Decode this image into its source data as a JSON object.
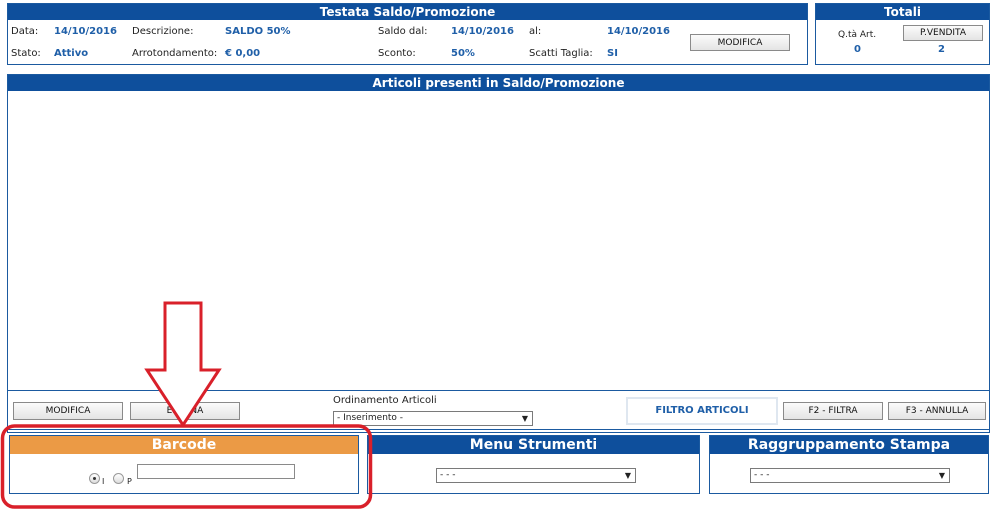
{
  "header": {
    "title": "Testata Saldo/Promozione",
    "data_label": "Data:",
    "data_value": "14/10/2016",
    "descr_label": "Descrizione:",
    "descr_value": "SALDO 50%",
    "saldo_dal_label": "Saldo dal:",
    "saldo_dal_value": "14/10/2016",
    "al_label": "al:",
    "al_value": "14/10/2016",
    "stato_label": "Stato:",
    "stato_value": "Attivo",
    "arrot_label": "Arrotondamento:",
    "arrot_value": "€ 0,00",
    "sconto_label": "Sconto:",
    "sconto_value": "50%",
    "scatti_label": "Scatti Taglia:",
    "scatti_value": "SI",
    "modifica_label": "MODIFICA"
  },
  "totali": {
    "title": "Totali",
    "qta_label": "Q.tà Art.",
    "qta_value": "0",
    "pvendita_label": "P.VENDITA",
    "pvendita_value": "2"
  },
  "articoli": {
    "title": "Articoli presenti in Saldo/Promozione"
  },
  "toolbar": {
    "modifica_label": "MODIFICA",
    "elimina_label": "ELIMINA",
    "ordinamento_label": "Ordinamento Articoli",
    "ordinamento_value": "- Inserimento -",
    "filtro_label": "FILTRO ARTICOLI",
    "filtra_label": "F2 - FILTRA",
    "annulla_label": "F3 - ANNULLA"
  },
  "barcode": {
    "title": "Barcode",
    "radio_i_label": "I",
    "radio_p_label": "P",
    "input_value": ""
  },
  "menu_strumenti": {
    "title": "Menu Strumenti",
    "selected": "- - -"
  },
  "raggruppamento": {
    "title": "Raggruppamento Stampa",
    "selected": "- - -"
  },
  "colors": {
    "header_blue": "#0e4f9c",
    "value_blue": "#1f5fa8",
    "barcode_orange": "#eb9a45",
    "annotation_red": "#d9202a"
  }
}
